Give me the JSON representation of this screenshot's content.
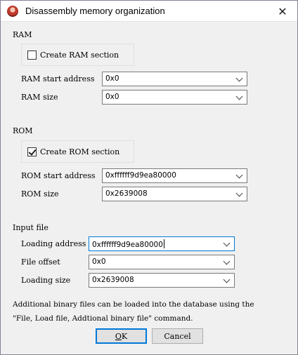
{
  "window": {
    "title": "Disassembly memory organization"
  },
  "ram": {
    "section_label": "RAM",
    "create_label": "Create RAM section",
    "create_checked": false,
    "start_label": "RAM start address",
    "start_value": "0x0",
    "size_label": "RAM size",
    "size_value": "0x0"
  },
  "rom": {
    "section_label": "ROM",
    "create_label": "Create ROM section",
    "create_checked": true,
    "start_label": "ROM start address",
    "start_value": "0xffffff9d9ea80000",
    "size_label": "ROM size",
    "size_value": "0x2639008"
  },
  "input_file": {
    "section_label": "Input file",
    "loading_address_label": "Loading address",
    "loading_address_value": "0xffffff9d9ea80000",
    "file_offset_label": "File offset",
    "file_offset_value": "0x0",
    "loading_size_label": "Loading size",
    "loading_size_value": "0x2639008"
  },
  "note": {
    "line1": "Additional binary files can be loaded into the database using the",
    "line2": "\"File, Load file, Addtional binary file\" command."
  },
  "buttons": {
    "ok_mnemonic": "O",
    "ok_rest": "K",
    "cancel": "Cancel"
  }
}
